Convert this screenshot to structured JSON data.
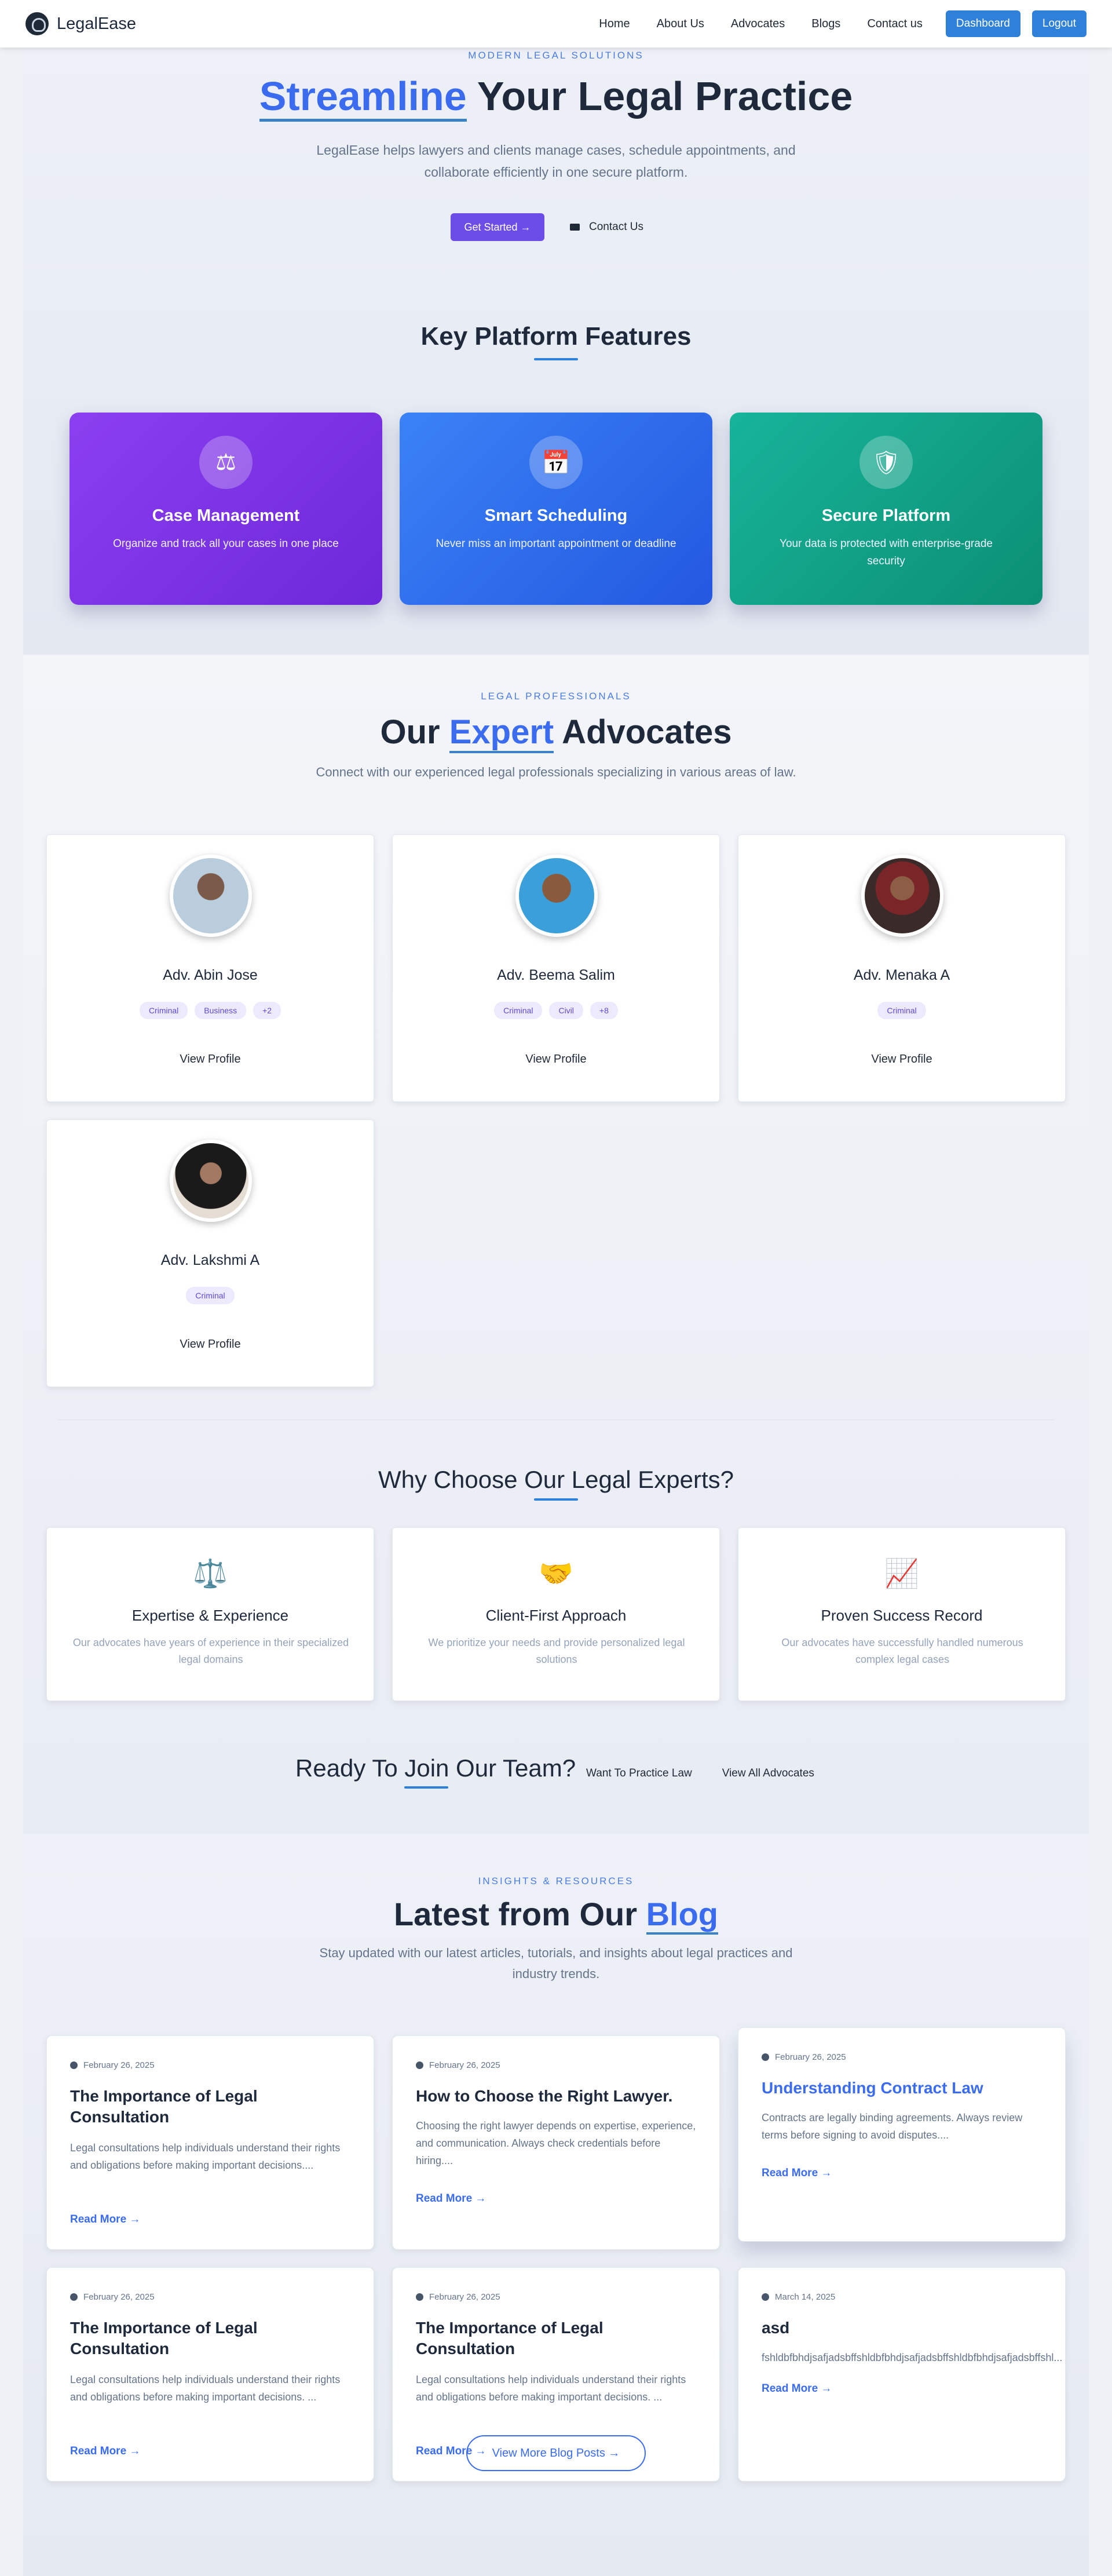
{
  "nav": {
    "brand": "LegalEase",
    "links": [
      "Home",
      "About Us",
      "Advocates",
      "Blogs",
      "Contact us"
    ],
    "dashboard": "Dashboard",
    "logout": "Logout"
  },
  "hero": {
    "eyebrow": "MODERN LEGAL SOLUTIONS",
    "title_highlight": "Streamline",
    "title_rest": " Your Legal Practice",
    "subtitle": "LegalEase helps lawyers and clients manage cases, schedule appointments, and collaborate efficiently in one secure platform.",
    "cta_primary": "Get Started →",
    "cta_secondary": "Contact Us"
  },
  "features": {
    "title": "Key Platform Features",
    "items": [
      {
        "icon": "scale-icon",
        "title": "Case Management",
        "desc": "Organize and track all your cases in one place",
        "color": "#7c3aed"
      },
      {
        "icon": "calendar-check-icon",
        "title": "Smart Scheduling",
        "desc": "Never miss an important appointment or deadline",
        "color": "#2563eb"
      },
      {
        "icon": "shield-icon",
        "title": "Secure Platform",
        "desc": "Your data is protected with enterprise-grade security",
        "color": "#10b981"
      }
    ]
  },
  "advocates": {
    "eyebrow": "LEGAL PROFESSIONALS",
    "title_pre": "Our ",
    "title_highlight": "Expert",
    "title_post": " Advocates",
    "subtitle": "Connect with our experienced legal professionals specializing in various areas of law.",
    "view_profile": "View Profile",
    "cards": [
      {
        "name": "Adv. Abin Jose",
        "tags": [
          "Criminal",
          "Business",
          "+2"
        ]
      },
      {
        "name": "Adv. Beema Salim",
        "tags": [
          "Criminal",
          "Civil",
          "+8"
        ]
      },
      {
        "name": "Adv. Menaka A",
        "tags": [
          "Criminal"
        ]
      },
      {
        "name": "Adv. Lakshmi A",
        "tags": [
          "Criminal"
        ]
      }
    ]
  },
  "why": {
    "title": "Why Choose Our Legal Experts?",
    "items": [
      {
        "icon": "⚖️",
        "title": "Expertise & Experience",
        "desc": "Our advocates have years of experience in their specialized legal domains"
      },
      {
        "icon": "🤝",
        "title": "Client-First Approach",
        "desc": "We prioritize your needs and provide personalized legal solutions"
      },
      {
        "icon": "📈",
        "title": "Proven Success Record",
        "desc": "Our advocates have successfully handled numerous complex legal cases"
      }
    ]
  },
  "join": {
    "title": "Ready To Join Our Team?",
    "link1": "Want To Practice Law",
    "link2": "View All Advocates"
  },
  "blog": {
    "eyebrow": "INSIGHTS & RESOURCES",
    "title_pre": "Latest from Our ",
    "title_highlight": "Blog",
    "subtitle": "Stay updated with our latest articles, tutorials, and insights about legal practices and industry trends.",
    "read_more": "Read More →",
    "view_more": "View More Blog Posts →",
    "posts": [
      {
        "date": "February 26, 2025",
        "title": "The Importance of Legal Consultation",
        "excerpt": "Legal consultations help individuals understand their rights and obligations before making important decisions...."
      },
      {
        "date": "February 26, 2025",
        "title": "How to Choose the Right Lawyer.",
        "excerpt": "Choosing the right lawyer depends on expertise, experience, and communication. Always check credentials before hiring...."
      },
      {
        "date": "February 26, 2025",
        "title": "Understanding Contract Law",
        "excerpt": "Contracts are legally binding agreements. Always review terms before signing to avoid disputes...."
      },
      {
        "date": "February 26, 2025",
        "title": "The Importance of Legal Consultation",
        "excerpt": "Legal consultations help individuals understand their rights and obligations before making important decisions. ..."
      },
      {
        "date": "February 26, 2025",
        "title": "The Importance of Legal Consultation",
        "excerpt": "Legal consultations help individuals understand their rights and obligations before making important decisions. ..."
      },
      {
        "date": "March 14, 2025",
        "title": "asd",
        "excerpt": "fshldbfbhdjsafjadsbffshldbfbhdjsafjadsbffshldbfbhdjsafjadsbffshl..."
      }
    ]
  }
}
